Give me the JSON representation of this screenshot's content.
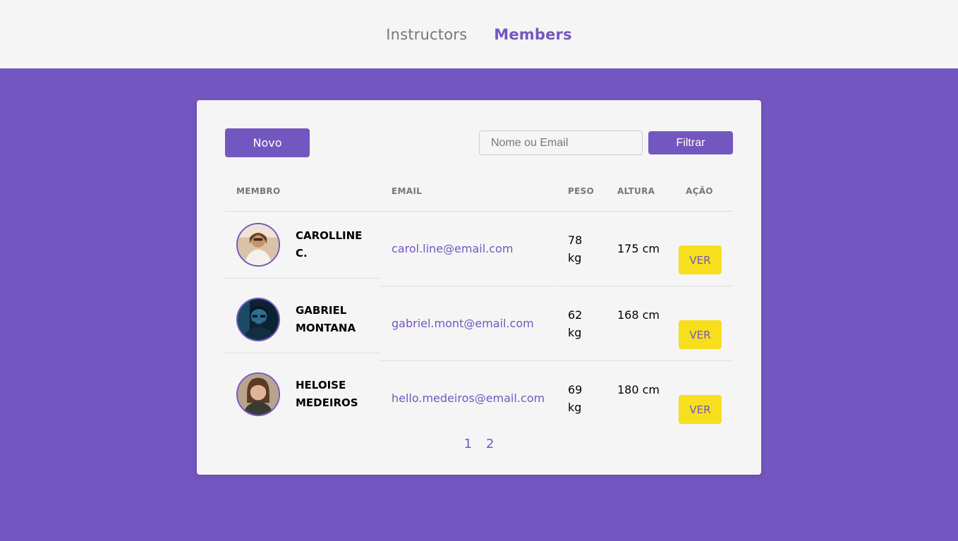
{
  "nav": {
    "instructors_label": "Instructors",
    "members_label": "Members"
  },
  "toolbar": {
    "new_label": "Novo",
    "search_placeholder": "Nome ou Email",
    "search_value": "",
    "filter_label": "Filtrar"
  },
  "table": {
    "headers": {
      "member": "MEMBRO",
      "email": "EMAIL",
      "weight": "PESO",
      "height": "ALTURA",
      "action": "AÇÃO"
    },
    "rows": [
      {
        "name": "CAROLLINE C.",
        "email": "carol.line@email.com",
        "weight": "78 kg",
        "height": "175 cm",
        "action": "VER",
        "avatar": "woman-smiling-photo"
      },
      {
        "name": "GABRIEL MONTANA",
        "email": "gabriel.mont@email.com",
        "weight": "62 kg",
        "height": "168 cm",
        "action": "VER",
        "avatar": "man-glasses-blue-photo"
      },
      {
        "name": "HELOISE MEDEIROS",
        "email": "hello.medeiros@email.com",
        "weight": "69 kg",
        "height": "180 cm",
        "action": "VER",
        "avatar": "woman-portrait-photo"
      }
    ]
  },
  "pagination": {
    "pages": [
      "1",
      "2"
    ]
  },
  "colors": {
    "primary": "#7357c0",
    "accent": "#f7df1e",
    "background": "#f5f5f5",
    "muted": "#777777"
  }
}
